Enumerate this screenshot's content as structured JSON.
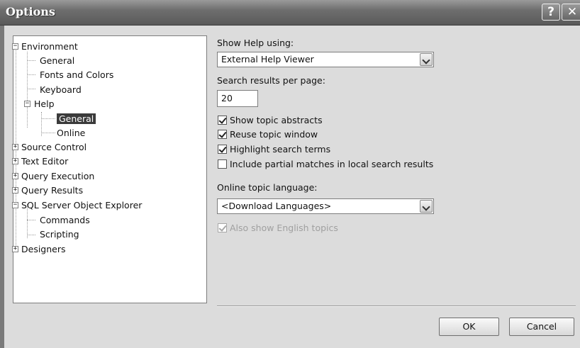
{
  "window": {
    "title": "Options",
    "help_glyph": "?",
    "close_glyph": "✕"
  },
  "tree": {
    "items": [
      {
        "label": "Environment",
        "expander": "−"
      },
      {
        "label": "General"
      },
      {
        "label": "Fonts and Colors"
      },
      {
        "label": "Keyboard"
      },
      {
        "label": "Help",
        "expander": "−"
      },
      {
        "label": "General",
        "selected": true
      },
      {
        "label": "Online"
      },
      {
        "label": "Source Control",
        "expander": "+"
      },
      {
        "label": "Text Editor",
        "expander": "+"
      },
      {
        "label": "Query Execution",
        "expander": "+"
      },
      {
        "label": "Query Results",
        "expander": "+"
      },
      {
        "label": "SQL Server Object Explorer",
        "expander": "−"
      },
      {
        "label": "Commands"
      },
      {
        "label": "Scripting"
      },
      {
        "label": "Designers",
        "expander": "+"
      }
    ]
  },
  "settings": {
    "show_help_label": "Show Help using:",
    "show_help_value": "External Help Viewer",
    "results_per_page_label": "Search results per page:",
    "results_per_page_value": "20",
    "checks": [
      {
        "label": "Show topic abstracts",
        "checked": true
      },
      {
        "label": "Reuse topic window",
        "checked": true
      },
      {
        "label": "Highlight search terms",
        "checked": true
      },
      {
        "label": "Include partial matches in local search results",
        "checked": false
      }
    ],
    "online_language_label": "Online topic language:",
    "online_language_value": "<Download Languages>",
    "english_topics_label": "Also show English topics",
    "english_topics_checked": true
  },
  "buttons": {
    "ok": "OK",
    "cancel": "Cancel"
  }
}
